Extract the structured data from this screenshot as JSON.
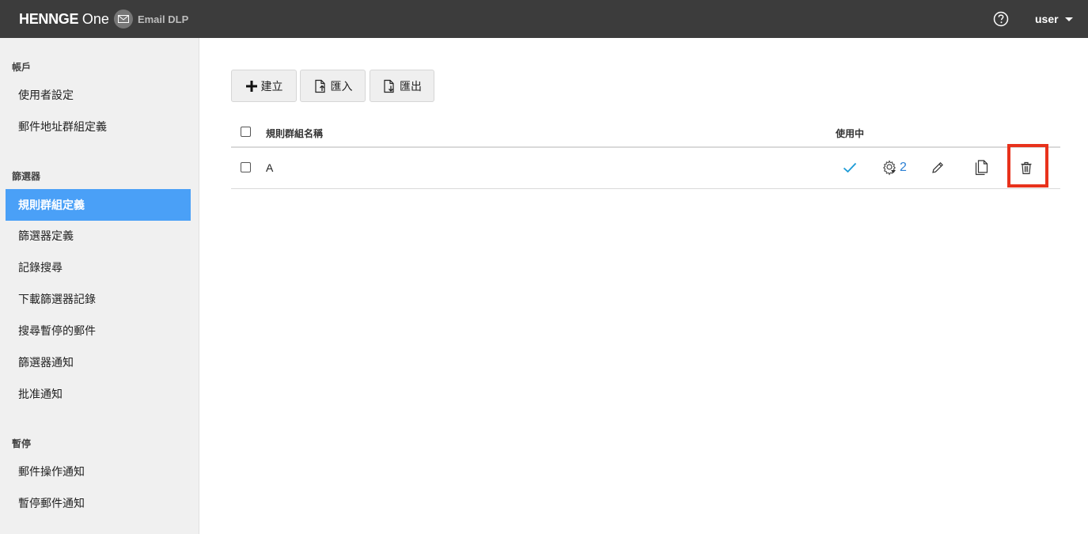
{
  "header": {
    "brand": "HENNGE",
    "brand_one": "One",
    "product": "Email DLP",
    "user_label": "user"
  },
  "sidebar": {
    "sections": [
      {
        "title": "帳戶",
        "items": [
          "使用者設定",
          "郵件地址群組定義"
        ]
      },
      {
        "title": "篩選器",
        "items": [
          "規則群組定義",
          "篩選器定義",
          "記錄搜尋",
          "下載篩選器記錄",
          "搜尋暫停的郵件",
          "篩選器通知",
          "批准通知"
        ]
      },
      {
        "title": "暫停",
        "items": [
          "郵件操作通知",
          "暫停郵件通知"
        ]
      }
    ],
    "active_item": "規則群組定義"
  },
  "toolbar": {
    "create_label": "建立",
    "import_label": "匯入",
    "export_label": "匯出"
  },
  "table": {
    "headers": {
      "name": "規則群組名稱",
      "in_use": "使用中"
    },
    "rows": [
      {
        "name": "A",
        "in_use": true,
        "rule_count": "2"
      }
    ]
  },
  "colors": {
    "header_bg": "#3c3c3c",
    "sidebar_bg": "#f0f0f0",
    "active_bg": "#4aa0f7",
    "check_color": "#1a9ad6",
    "highlight": "#e8321c"
  },
  "icons": {
    "help": "question-circle-icon",
    "create": "plus-icon",
    "import": "file-upload-icon",
    "export": "file-download-icon",
    "in_use": "checkmark-icon",
    "rules": "gear-icon",
    "edit": "pencil-icon",
    "copy": "copy-icon",
    "delete": "trash-icon"
  }
}
